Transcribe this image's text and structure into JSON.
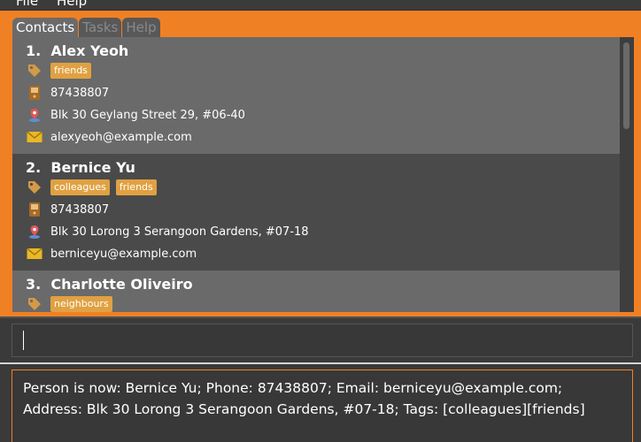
{
  "menubar": {
    "items": [
      "File",
      "Help"
    ]
  },
  "tabs": [
    {
      "label": "Contacts",
      "active": true
    },
    {
      "label": "Tasks",
      "active": false
    },
    {
      "label": "Help",
      "active": false
    }
  ],
  "contacts": [
    {
      "index": "1.",
      "name": "Alex Yeoh",
      "tags": [
        "friends"
      ],
      "phone": "87438807",
      "address": "Blk 30 Geylang Street 29, #06-40",
      "email": "alexyeoh@example.com"
    },
    {
      "index": "2.",
      "name": "Bernice Yu",
      "tags": [
        "colleagues",
        "friends"
      ],
      "phone": "87438807",
      "address": "Blk 30 Lorong 3 Serangoon Gardens, #07-18",
      "email": "berniceyu@example.com"
    },
    {
      "index": "3.",
      "name": "Charlotte Oliveiro",
      "tags": [
        "neighbours"
      ]
    }
  ],
  "icons": {
    "tag": "tag-icon",
    "phone": "phone-icon",
    "address": "location-pin-icon",
    "email": "envelope-icon"
  },
  "command": {
    "value": ""
  },
  "result": {
    "text": "Person is now: Bernice Yu; Phone: 87438807; Email: berniceyu@example.com;\nAddress: Blk 30 Lorong 3 Serangoon Gardens, #07-18; Tags: [colleagues][friends]"
  },
  "colors": {
    "accent": "#f08024",
    "tag": "#e0a142",
    "card_odd": "#6a6a6a",
    "card_even": "#4a4a4a",
    "background": "#3a3a3a"
  }
}
